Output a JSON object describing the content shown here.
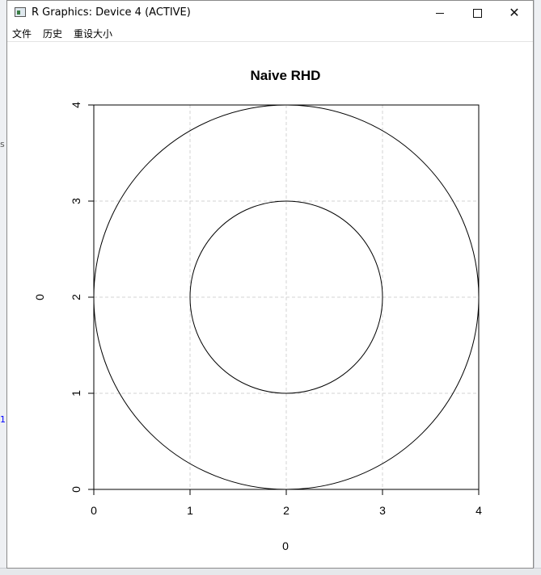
{
  "window": {
    "title": "R Graphics: Device 4 (ACTIVE)",
    "controls": {
      "minimize_icon": "minimize-icon",
      "maximize_icon": "maximize-icon",
      "close_icon": "close-icon"
    }
  },
  "menu": {
    "items": [
      {
        "label": "文件"
      },
      {
        "label": "历史"
      },
      {
        "label": "重设大小"
      }
    ]
  },
  "background": {
    "left_marks": [
      "s",
      "1"
    ],
    "accent_link_color": "#0000ff"
  },
  "chart_data": {
    "type": "line",
    "title": "Naive RHD",
    "xlabel": "0",
    "ylabel": "0",
    "xlim": [
      0,
      4
    ],
    "ylim": [
      0,
      4
    ],
    "x_ticks": [
      "0",
      "1",
      "2",
      "3",
      "4"
    ],
    "y_ticks": [
      "0",
      "1",
      "2",
      "3",
      "4"
    ],
    "grid": "dashed, light gray, at each tick",
    "series": [
      {
        "shape": "circle",
        "center": [
          2,
          2
        ],
        "radius": 2,
        "color": "#000000"
      },
      {
        "shape": "circle",
        "center": [
          2,
          2
        ],
        "radius": 1,
        "color": "#000000"
      }
    ]
  }
}
